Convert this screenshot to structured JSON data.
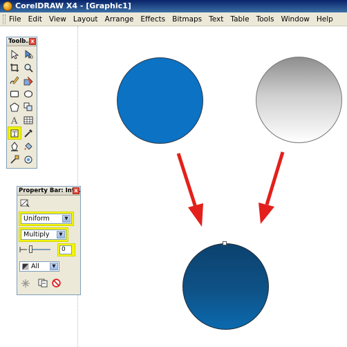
{
  "window": {
    "title": "CorelDRAW X4 - [Graphic1]"
  },
  "menu": {
    "items": [
      "File",
      "Edit",
      "View",
      "Layout",
      "Arrange",
      "Effects",
      "Bitmaps",
      "Text",
      "Table",
      "Tools",
      "Window",
      "Help"
    ]
  },
  "toolbox": {
    "title": "Toolb...",
    "close": "x"
  },
  "propbar": {
    "title": "Property Bar: Int...",
    "close": "x",
    "type_value": "Uniform",
    "mode_value": "Multiply",
    "amount_value": "0",
    "apply_value": "All"
  },
  "colors": {
    "highlight": "#f2f30a",
    "blue_circle": "#0b72c4",
    "result_circle": "#0e5287",
    "arrow": "#e3201b"
  }
}
